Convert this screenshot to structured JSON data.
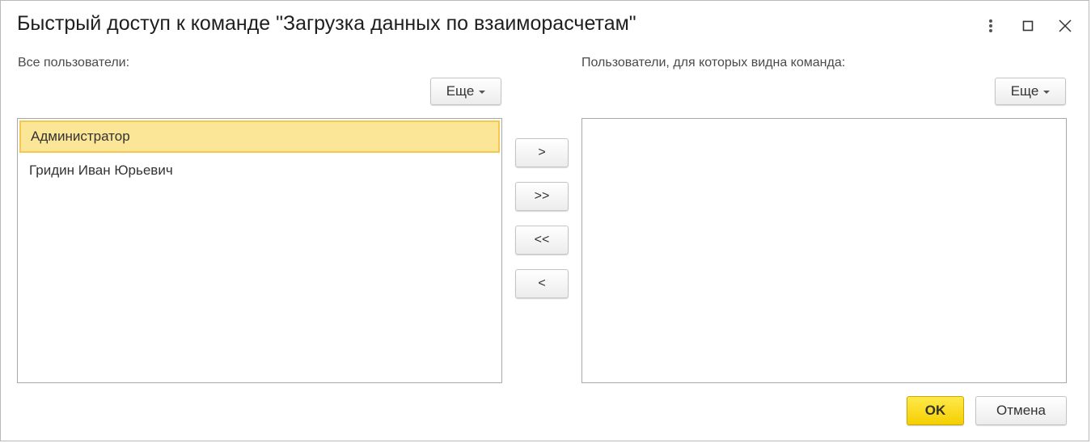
{
  "window": {
    "title": "Быстрый доступ к команде \"Загрузка данных по взаиморасчетам\"",
    "menu_icon": "more-vertical-icon",
    "maximize_icon": "maximize-icon",
    "close_icon": "close-icon"
  },
  "left_panel": {
    "label": "Все пользователи:",
    "more_label": "Еще",
    "items": [
      {
        "label": "Администратор",
        "selected": true
      },
      {
        "label": "Гридин Иван Юрьевич",
        "selected": false
      }
    ]
  },
  "transfer_buttons": {
    "add": ">",
    "add_all": ">>",
    "remove_all": "<<",
    "remove": "<"
  },
  "right_panel": {
    "label": "Пользователи, для которых видна команда:",
    "more_label": "Еще",
    "items": []
  },
  "footer": {
    "ok_label": "OK",
    "cancel_label": "Отмена"
  },
  "colors": {
    "selection_bg": "#fbe597",
    "selection_border": "#f2c94c",
    "ok_button": "#f4cf00"
  }
}
